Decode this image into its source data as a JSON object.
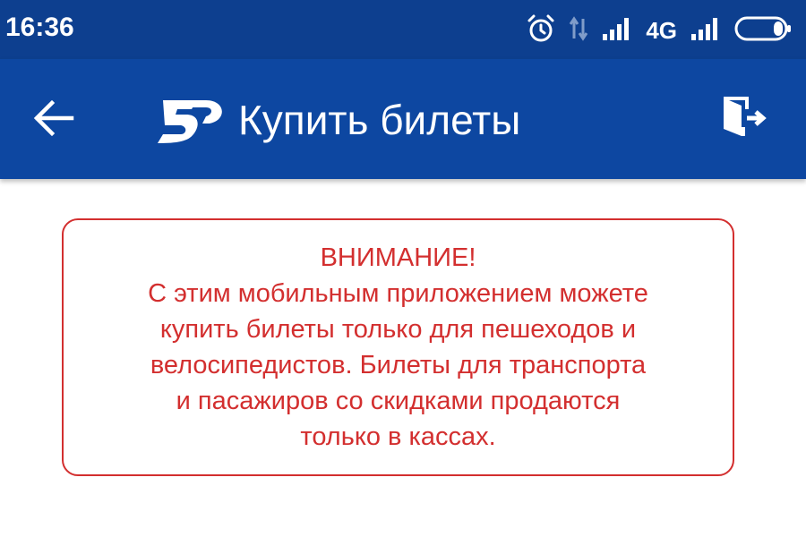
{
  "status_bar": {
    "time": "16:36",
    "network_type": "4G",
    "icons": [
      "alarm-icon",
      "data-transfer-icon",
      "signal-icon",
      "signal-icon",
      "battery-icon"
    ]
  },
  "app_bar": {
    "title": "Купить билеты",
    "back_icon": "arrow-left-icon",
    "logout_icon": "exit-door-icon",
    "background": "#0d47a1"
  },
  "warning": {
    "title": "ВНИМАНИЕ!",
    "lines": [
      "С этим мобильным приложением можете",
      "купить билеты только для пешеходов и",
      "велосипедистов. Билеты для транспорта",
      "и пасажиров со скидками продаются",
      "только в кассах."
    ],
    "color": "#d32f2f"
  }
}
